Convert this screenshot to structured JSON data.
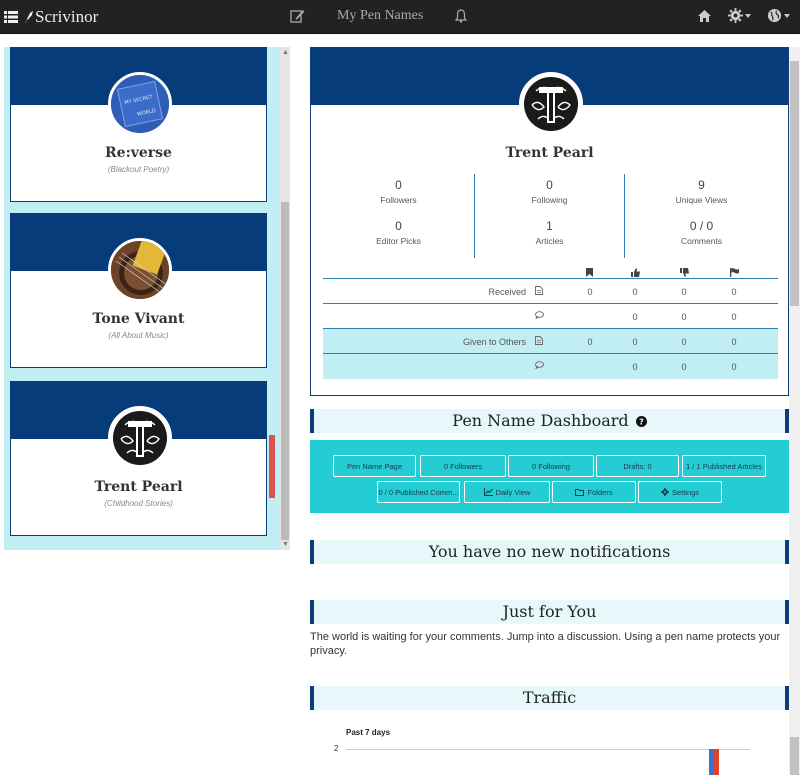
{
  "topbar": {
    "brand": "Scrivinor",
    "title": "My Pen Names"
  },
  "pen_names": [
    {
      "name": "Re:verse",
      "description": "(Blackout Poetry)",
      "avatar_text": "MY SECRET WORLD"
    },
    {
      "name": "Tone Vivant",
      "description": "(All About Music)"
    },
    {
      "name": "Trent Pearl",
      "description": "(Childhood Stories)"
    }
  ],
  "profile": {
    "name": "Trent Pearl",
    "stats": [
      {
        "value": "0",
        "label": "Followers"
      },
      {
        "value": "0",
        "label": "Following"
      },
      {
        "value": "9",
        "label": "Unique Views"
      },
      {
        "value": "0",
        "label": "Editor Picks"
      },
      {
        "value": "1",
        "label": "Articles"
      },
      {
        "value": "0 / 0",
        "label": "Comments"
      }
    ],
    "interactions": {
      "header_icons": [
        "bookmark-icon",
        "thumbs-up-icon",
        "thumbs-down-icon",
        "flag-icon"
      ],
      "rows": [
        {
          "label": "Received",
          "icon": "document-icon",
          "values": [
            "0",
            "0",
            "0",
            "0"
          ]
        },
        {
          "label": "",
          "icon": "comment-icon",
          "values": [
            "0",
            "0",
            "0"
          ]
        },
        {
          "label": "Given to Others",
          "icon": "document-icon",
          "values": [
            "0",
            "0",
            "0",
            "0"
          ]
        },
        {
          "label": "",
          "icon": "comment-icon",
          "values": [
            "0",
            "0",
            "0"
          ]
        }
      ]
    }
  },
  "dashboard": {
    "title": "Pen Name Dashboard",
    "buttons": [
      {
        "label": "Pen Name Page"
      },
      {
        "label": "0 Followers"
      },
      {
        "label": "0 Following"
      },
      {
        "label": "Drafts: 0"
      },
      {
        "label": "1 / 1 Published Articles"
      },
      {
        "label": "0 / 0 Published Comm..."
      },
      {
        "label": "Daily View",
        "icon": "chart-icon"
      },
      {
        "label": "Folders",
        "icon": "folder-icon"
      },
      {
        "label": "Settings",
        "icon": "gear-icon"
      }
    ]
  },
  "notifications": {
    "title": "You have no new notifications"
  },
  "just_for_you": {
    "title": "Just for You",
    "text": "The world is waiting for your comments. Jump into a discussion. Using a pen name protects your privacy."
  },
  "traffic": {
    "title": "Traffic",
    "colors": {
      "series_a": "#3b6fd4",
      "series_b": "#e0432d"
    }
  },
  "chart_data": {
    "type": "bar",
    "title": "Past 7 days",
    "y_ticks": [
      "2"
    ],
    "series": [
      {
        "values": [
          2
        ],
        "color": "#3b6fd4"
      },
      {
        "values": [
          2
        ],
        "color": "#e0432d"
      }
    ]
  }
}
